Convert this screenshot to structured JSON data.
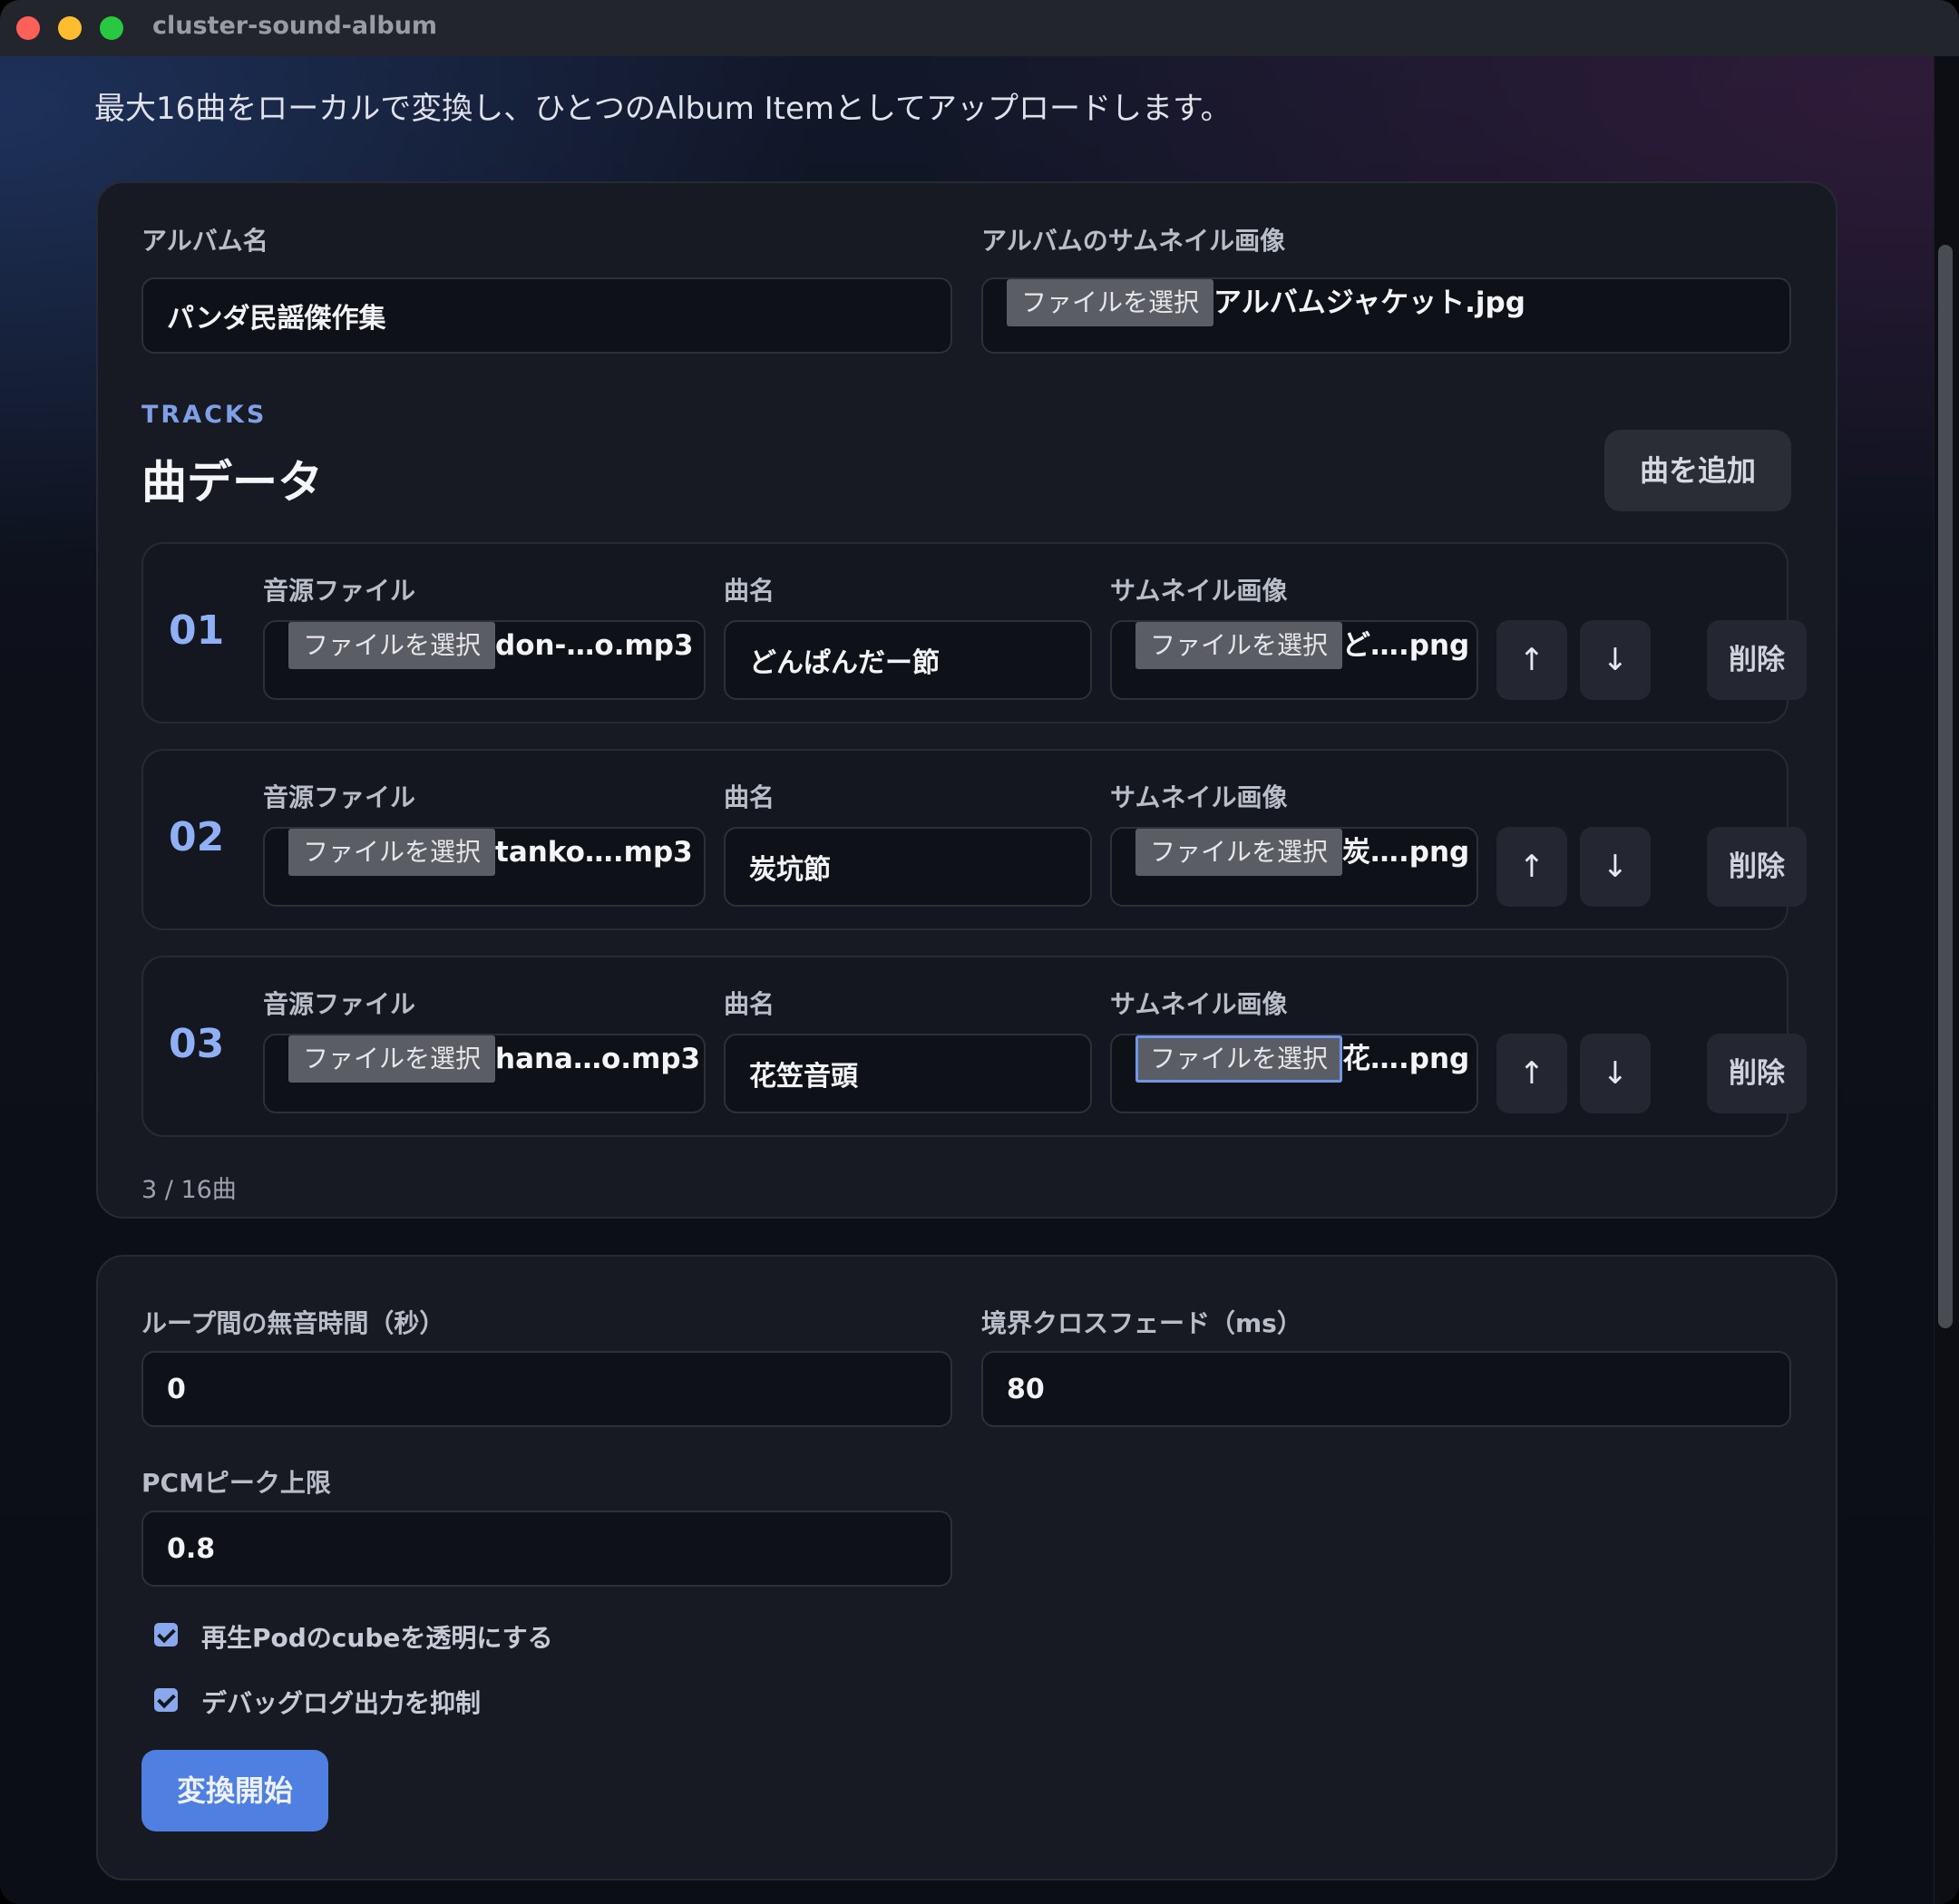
{
  "window": {
    "title": "cluster-sound-album"
  },
  "intro": "最大16曲をローカルで変換し、ひとつのAlbum Itemとしてアップロードします。",
  "album": {
    "name_label": "アルバム名",
    "name_value": "パンダ民謡傑作集",
    "thumb_label": "アルバムのサムネイル画像",
    "choose_label": "ファイルを選択",
    "thumb_file": "アルバムジャケット.jpg"
  },
  "tracks": {
    "kicker": "TRACKS",
    "title": "曲データ",
    "add_label": "曲を追加",
    "audio_label": "音源ファイル",
    "name_label": "曲名",
    "thumb_label": "サムネイル画像",
    "choose_label": "ファイルを選択",
    "up_label": "↑",
    "down_label": "↓",
    "delete_label": "削除",
    "items": [
      {
        "num": "01",
        "audio_file": "don-…o.mp3",
        "name": "どんぱんだー節",
        "thumb_file": "ど….png"
      },
      {
        "num": "02",
        "audio_file": "tanko….mp3",
        "name": "炭坑節",
        "thumb_file": "炭….png"
      },
      {
        "num": "03",
        "audio_file": "hana…o.mp3",
        "name": "花笠音頭",
        "thumb_file": "花….png"
      }
    ],
    "count": "3 / 16曲"
  },
  "settings": {
    "silence_label": "ループ間の無音時間（秒）",
    "silence_value": "0",
    "crossfade_label": "境界クロスフェード（ms）",
    "crossfade_value": "80",
    "peak_label": "PCMピーク上限",
    "peak_value": "0.8",
    "transparent_label": "再生Podのcubeを透明にする",
    "transparent_checked": true,
    "debug_label": "デバッグログ出力を抑制",
    "debug_checked": true,
    "convert_label": "変換開始"
  },
  "colors": {
    "accent": "#4f7fe0",
    "kicker": "#7f9fe6",
    "track_number": "#8fb0f5",
    "card_bg": "#171a23"
  }
}
